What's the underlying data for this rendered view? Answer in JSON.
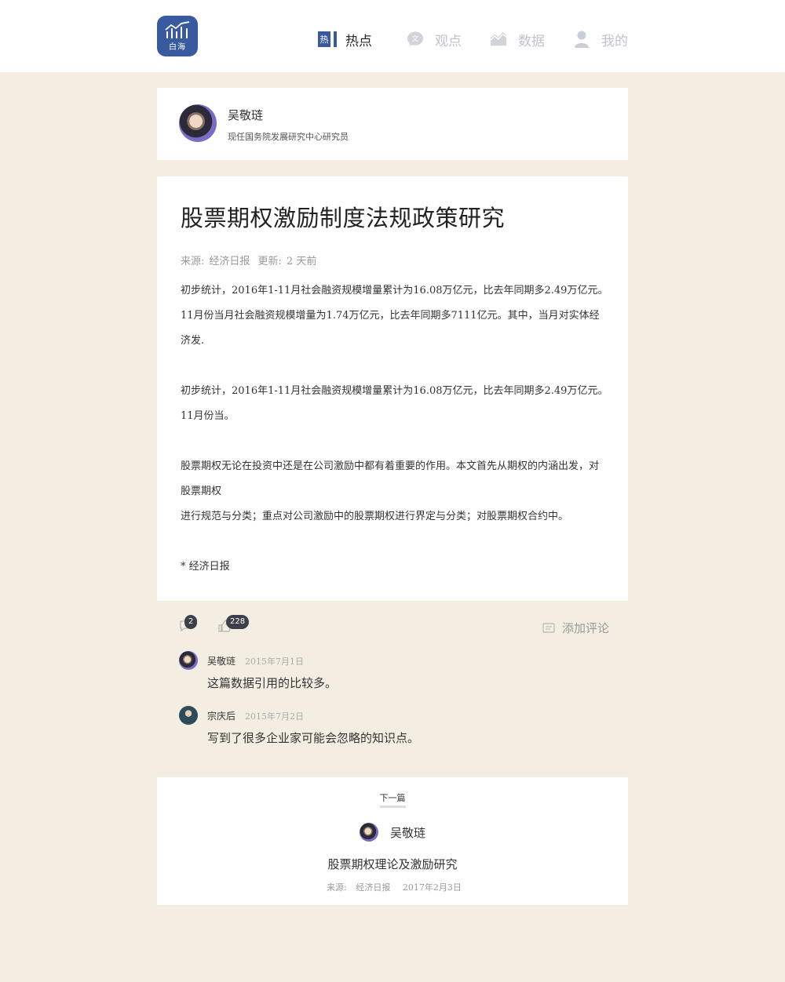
{
  "logo": {
    "text": "白海",
    "icon": "bar-chart-logo-icon"
  },
  "nav": [
    {
      "label": "热点",
      "icon": "hot-icon",
      "icon_text": "热",
      "active": true
    },
    {
      "label": "观点",
      "icon": "chat-bubble-icon",
      "icon_text": "文",
      "active": false
    },
    {
      "label": "数据",
      "icon": "area-chart-icon",
      "active": false
    },
    {
      "label": "我的",
      "icon": "user-icon",
      "active": false
    }
  ],
  "author": {
    "name": "吴敬琏",
    "title": "现任国务院发展研究中心研究员"
  },
  "article": {
    "title": "股票期权激励制度法规政策研究",
    "source_label": "来源:",
    "source": "经济日报",
    "updated_label": "更新:",
    "updated": "2 天前",
    "paragraphs": [
      "初步统计，2016年1-11月社会融资规模增量累计为16.08万亿元，比去年同期多2.49万亿元。11月份当月社会融资规模增量为1.74万亿元，比去年同期多7111亿元。其中，当月对实体经济发.",
      "初步统计，2016年1-11月社会融资规模增量累计为16.08万亿元，比去年同期多2.49万亿元。11月份当。",
      "股票期权无论在投资中还是在公司激励中都有着重要的作用。本文首先从期权的内涵出发，对股票期权",
      "进行规范与分类；重点对公司激励中的股票期权进行界定与分类；对股票期权合约中。",
      "* 经济日报"
    ]
  },
  "actions": {
    "comment_count": "2",
    "like_count": "228",
    "add_comment": "添加评论"
  },
  "comments": [
    {
      "name": "吴敬琏",
      "date": "2015年7月1日",
      "text": "这篇数据引用的比较多。"
    },
    {
      "name": "宗庆后",
      "date": "2015年7月2日",
      "text": "写到了很多企业家可能会忽略的知识点。"
    }
  ],
  "next": {
    "label": "下一篇",
    "author": "吴敬琏",
    "title": "股票期权理论及激励研究",
    "source_label": "来源:",
    "source": "经济日报",
    "date": "2017年2月3日"
  },
  "colors": {
    "brand": "#3a5aa0",
    "background": "#f4eee2",
    "badge": "#3a3f4a"
  }
}
